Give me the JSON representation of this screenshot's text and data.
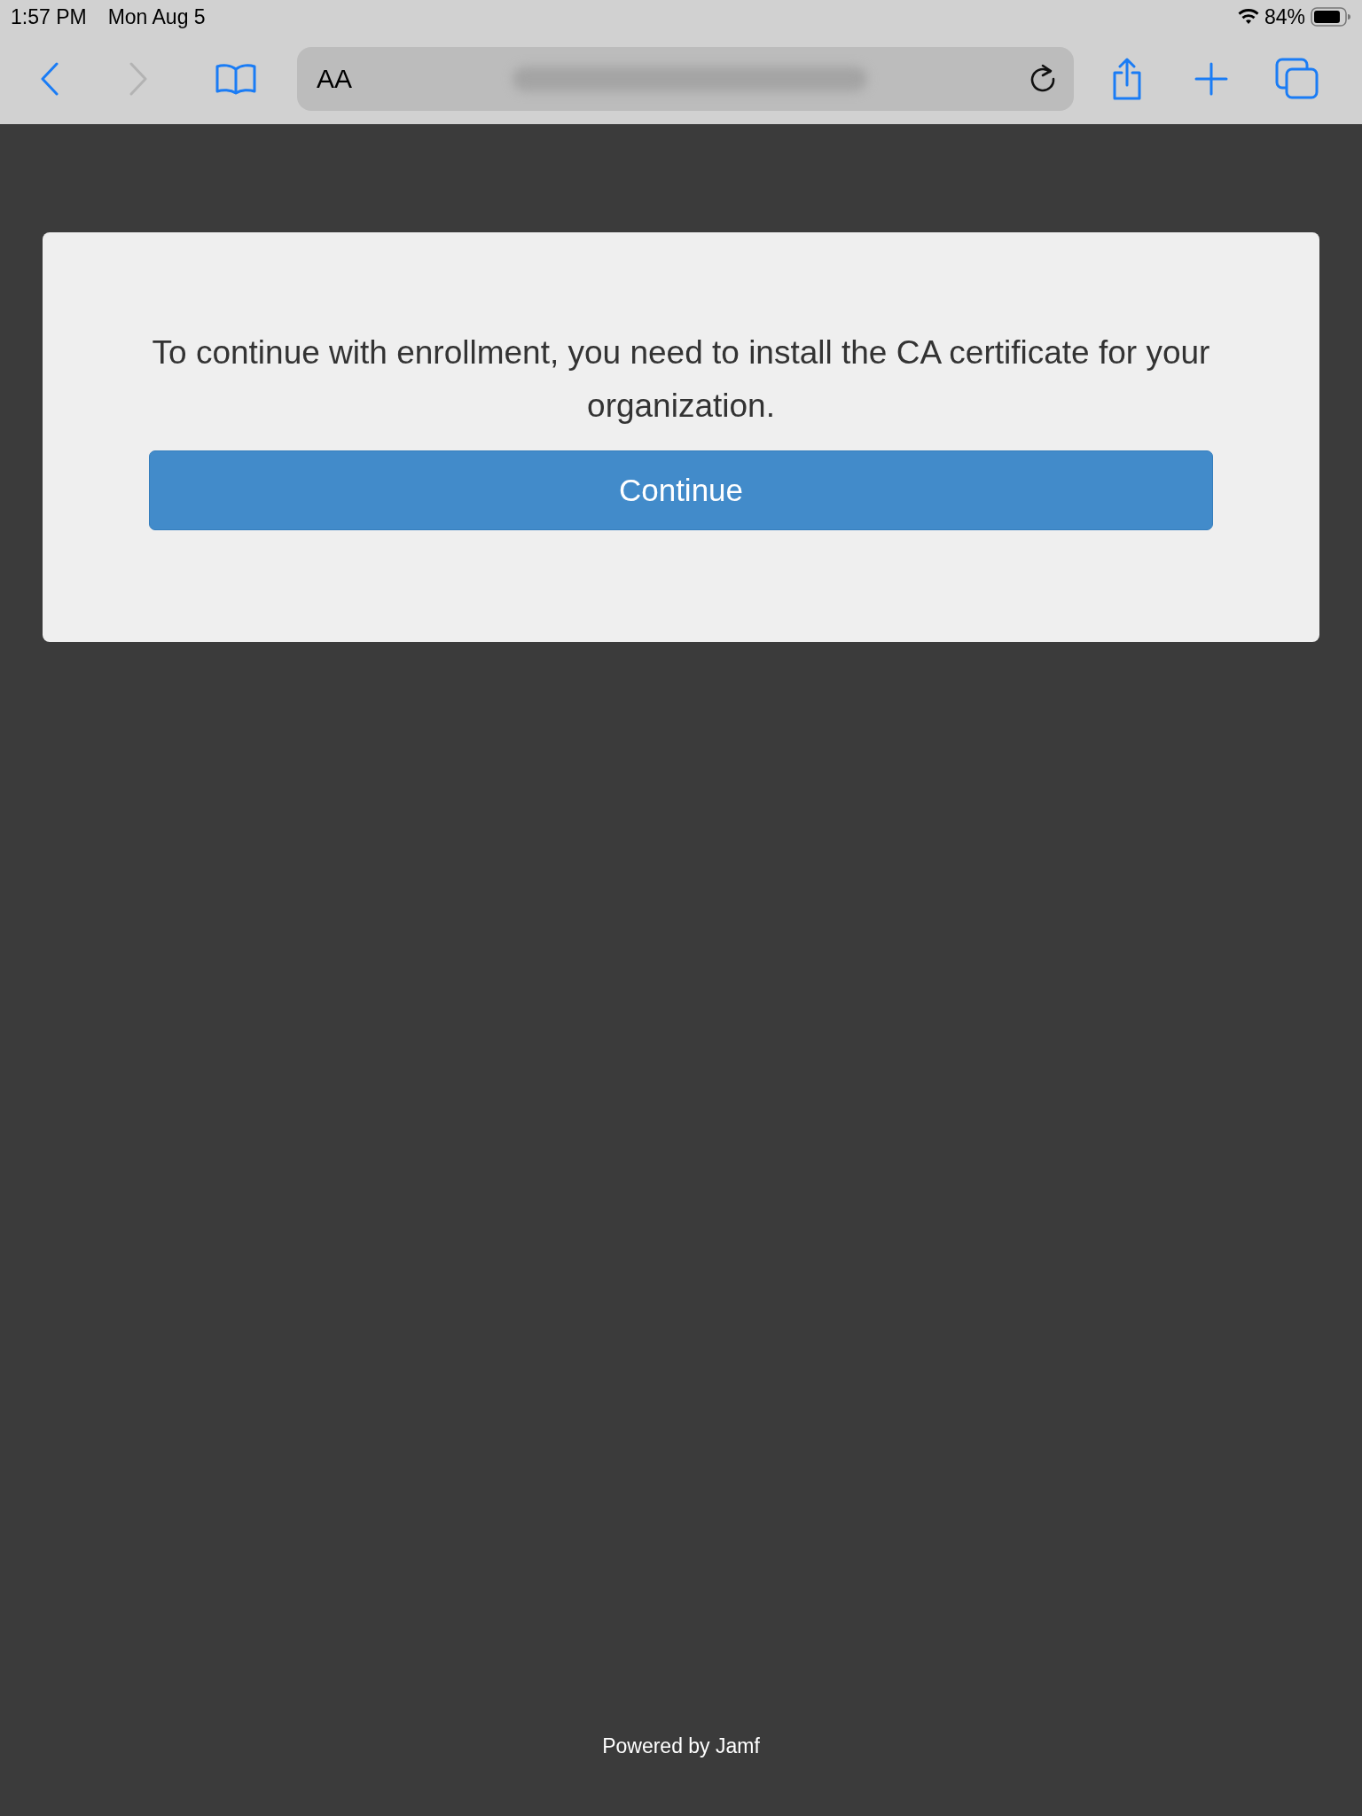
{
  "status_bar": {
    "time": "1:57 PM",
    "date": "Mon Aug 5",
    "battery": "84%"
  },
  "toolbar": {
    "back_disabled": false,
    "forward_disabled": true,
    "text_size_label": "AA"
  },
  "card": {
    "message": "To continue with enrollment, you need to install the CA certificate for your organization.",
    "button": "Continue"
  },
  "footer": "Powered by Jamf"
}
